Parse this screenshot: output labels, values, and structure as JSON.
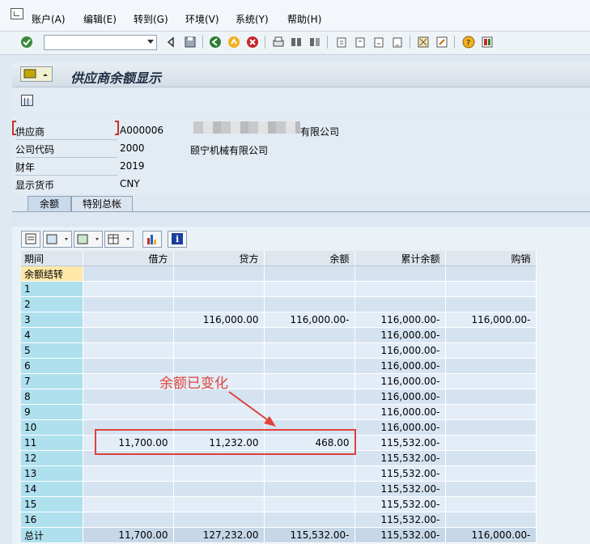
{
  "menu": [
    "账户(A)",
    "编辑(E)",
    "转到(G)",
    "环境(V)",
    "系统(Y)",
    "帮助(H)"
  ],
  "title": "供应商余额显示",
  "fields": [
    {
      "label": "供应商",
      "value": "A000006"
    },
    {
      "label": "公司代码",
      "value": "2000"
    },
    {
      "label": "财年",
      "value": "2019"
    },
    {
      "label": "显示货币",
      "value": "CNY"
    }
  ],
  "vendor_name_suffix": "有限公司",
  "company_name": "颐宁机械有限公司",
  "tabs": [
    "余额",
    "特别总帐"
  ],
  "columns": [
    "期间",
    "借方",
    "贷方",
    "余额",
    "累计余额",
    "购销"
  ],
  "rows": [
    {
      "period": "余额结转",
      "debit": "",
      "credit": "",
      "balance": "",
      "cumulative": "",
      "sales": ""
    },
    {
      "period": "1",
      "debit": "",
      "credit": "",
      "balance": "",
      "cumulative": "",
      "sales": ""
    },
    {
      "period": "2",
      "debit": "",
      "credit": "",
      "balance": "",
      "cumulative": "",
      "sales": ""
    },
    {
      "period": "3",
      "debit": "",
      "credit": "116,000.00",
      "balance": "116,000.00-",
      "cumulative": "116,000.00-",
      "sales": "116,000.00-"
    },
    {
      "period": "4",
      "debit": "",
      "credit": "",
      "balance": "",
      "cumulative": "116,000.00-",
      "sales": ""
    },
    {
      "period": "5",
      "debit": "",
      "credit": "",
      "balance": "",
      "cumulative": "116,000.00-",
      "sales": ""
    },
    {
      "period": "6",
      "debit": "",
      "credit": "",
      "balance": "",
      "cumulative": "116,000.00-",
      "sales": ""
    },
    {
      "period": "7",
      "debit": "",
      "credit": "",
      "balance": "",
      "cumulative": "116,000.00-",
      "sales": ""
    },
    {
      "period": "8",
      "debit": "",
      "credit": "",
      "balance": "",
      "cumulative": "116,000.00-",
      "sales": ""
    },
    {
      "period": "9",
      "debit": "",
      "credit": "",
      "balance": "",
      "cumulative": "116,000.00-",
      "sales": ""
    },
    {
      "period": "10",
      "debit": "",
      "credit": "",
      "balance": "",
      "cumulative": "116,000.00-",
      "sales": ""
    },
    {
      "period": "11",
      "debit": "11,700.00",
      "credit": "11,232.00",
      "balance": "468.00",
      "cumulative": "115,532.00-",
      "sales": ""
    },
    {
      "period": "12",
      "debit": "",
      "credit": "",
      "balance": "",
      "cumulative": "115,532.00-",
      "sales": ""
    },
    {
      "period": "13",
      "debit": "",
      "credit": "",
      "balance": "",
      "cumulative": "115,532.00-",
      "sales": ""
    },
    {
      "period": "14",
      "debit": "",
      "credit": "",
      "balance": "",
      "cumulative": "115,532.00-",
      "sales": ""
    },
    {
      "period": "15",
      "debit": "",
      "credit": "",
      "balance": "",
      "cumulative": "115,532.00-",
      "sales": ""
    },
    {
      "period": "16",
      "debit": "",
      "credit": "",
      "balance": "",
      "cumulative": "115,532.00-",
      "sales": ""
    }
  ],
  "total": {
    "period": "总计",
    "debit": "11,700.00",
    "credit": "127,232.00",
    "balance": "115,532.00-",
    "cumulative": "115,532.00-",
    "sales": "116,000.00-"
  },
  "annotation": "余额已变化",
  "colors": {
    "annotation": "#e0413b",
    "period_cell": "#aee0ee",
    "selected_cell": "#fde8a8"
  }
}
